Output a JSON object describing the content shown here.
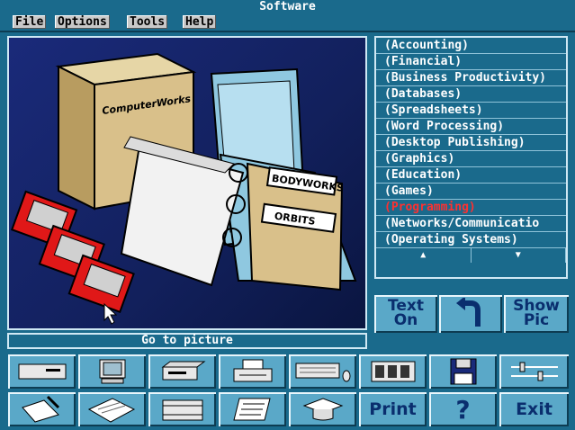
{
  "window": {
    "title": "Software"
  },
  "menu": {
    "file": "File",
    "options": "Options",
    "tools": "Tools",
    "help": "Help"
  },
  "picture": {
    "box_label": "ComputerWorks",
    "tab1": "BODYWORKS",
    "tab2": "ORBITS"
  },
  "goto": {
    "label": "Go to picture"
  },
  "categories": [
    "(Accounting)",
    "(Financial)",
    "(Business Productivity)",
    "(Databases)",
    "(Spreadsheets)",
    "(Word Processing)",
    "(Desktop Publishing)",
    "(Graphics)",
    "(Education)",
    "(Games)",
    "(Programming)",
    "(Networks/Communicatio",
    "(Operating Systems)"
  ],
  "selected_category": "(Programming)",
  "scroll": {
    "up": "▲",
    "down": "▼"
  },
  "actions": {
    "text_on": "Text On",
    "show_pic": "Show Pic"
  },
  "toolbar": {
    "print": "Print",
    "help": "?",
    "exit": "Exit"
  },
  "icons": {
    "back": "back-arrow-icon",
    "row1": [
      "system-unit-icon",
      "monitor-icon",
      "disk-drive-icon",
      "printer-icon",
      "keyboard-mouse-icon",
      "memory-board-icon",
      "floppy-disk-icon",
      "slider-controls-icon"
    ],
    "row2": [
      "writing-hand-icon",
      "documents-icon",
      "chip-icon",
      "manuals-icon",
      "graduation-cap-icon"
    ]
  },
  "colors": {
    "background": "#1a6a8c",
    "button": "#5aa8c8",
    "selected_text": "#ff3030"
  }
}
